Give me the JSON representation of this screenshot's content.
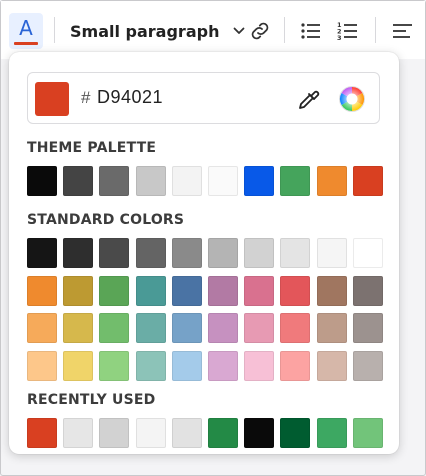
{
  "toolbar": {
    "font_color_glyph": "A",
    "text_style_label": "Small paragraph",
    "accent": "#2a64d6",
    "icons": [
      "font-color-icon",
      "chevron-down-icon",
      "link-icon",
      "bullet-list-icon",
      "numbered-list-icon",
      "align-left-icon"
    ]
  },
  "color_picker": {
    "hash_prefix": "#",
    "hex_value": "D94021",
    "selected_color": "#D94021",
    "eyedropper_icon": "eyedropper-icon",
    "picker_icon": "color-wheel-icon",
    "sections": [
      {
        "label": "THEME PALETTE",
        "rows": [
          [
            "#0a0a0a",
            "#444444",
            "#6a6a6a",
            "#c8c8c8",
            "#f3f3f3",
            "#fafafa",
            "#0859e8",
            "#45a45c",
            "#ef8a2e",
            "#d94021"
          ]
        ]
      },
      {
        "label": "STANDARD COLORS",
        "rows": [
          [
            "#151515",
            "#2e2e2e",
            "#4a4a4a",
            "#646464",
            "#8a8a8a",
            "#b4b4b4",
            "#d2d2d2",
            "#e4e4e4",
            "#f5f5f5",
            "#ffffff"
          ],
          [
            "#ef8a2e",
            "#bd9a32",
            "#5aa556",
            "#4a9a96",
            "#4a73a4",
            "#b27aa4",
            "#d9718f",
            "#e3565a",
            "#a07660",
            "#7c7270"
          ],
          [
            "#f6aa5a",
            "#d6b84c",
            "#72bd6c",
            "#6aada6",
            "#76a2c8",
            "#c691c0",
            "#e79ab3",
            "#f07a7c",
            "#bd9c8a",
            "#9c928f"
          ],
          [
            "#fdc78a",
            "#f0d469",
            "#90d280",
            "#8cc3b8",
            "#a4cbea",
            "#d9a8d2",
            "#f7c0d6",
            "#fca3a2",
            "#d6b7a9",
            "#b8b0ad"
          ]
        ]
      },
      {
        "label": "RECENTLY USED",
        "rows": [
          [
            "#d94021",
            "#e6e6e6",
            "#d2d2d2",
            "#f4f4f4",
            "#e2e2e2",
            "#238a46",
            "#0a0a0a",
            "#005c30",
            "#3da862",
            "#72c47a"
          ]
        ]
      }
    ]
  }
}
